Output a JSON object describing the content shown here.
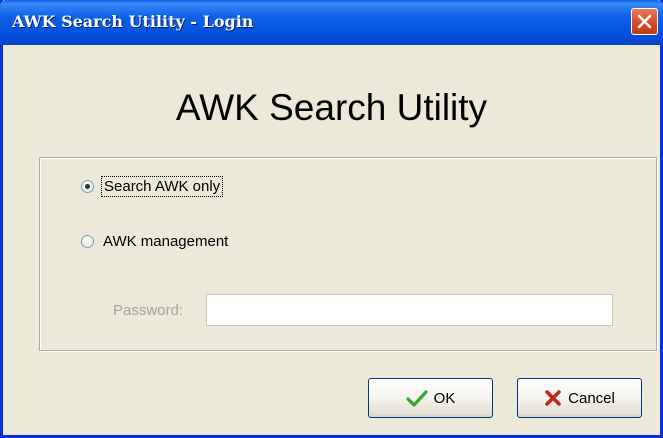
{
  "window": {
    "title": "AWK Search Utility - Login"
  },
  "heading": "AWK Search Utility",
  "options": [
    {
      "label": "Search AWK only",
      "selected": true
    },
    {
      "label": "AWK management",
      "selected": false
    }
  ],
  "password": {
    "label": "Password:",
    "value": ""
  },
  "buttons": {
    "ok_label": "OK",
    "cancel_label": "Cancel"
  },
  "icons": {
    "close": "close-icon",
    "ok": "checkmark-icon",
    "cancel": "x-icon"
  },
  "colors": {
    "titlebar": "#0A5FE8",
    "close_button": "#D8502C",
    "ok_icon": "#2FA82F",
    "cancel_icon": "#C0271B",
    "background": "#ECE9D8"
  }
}
